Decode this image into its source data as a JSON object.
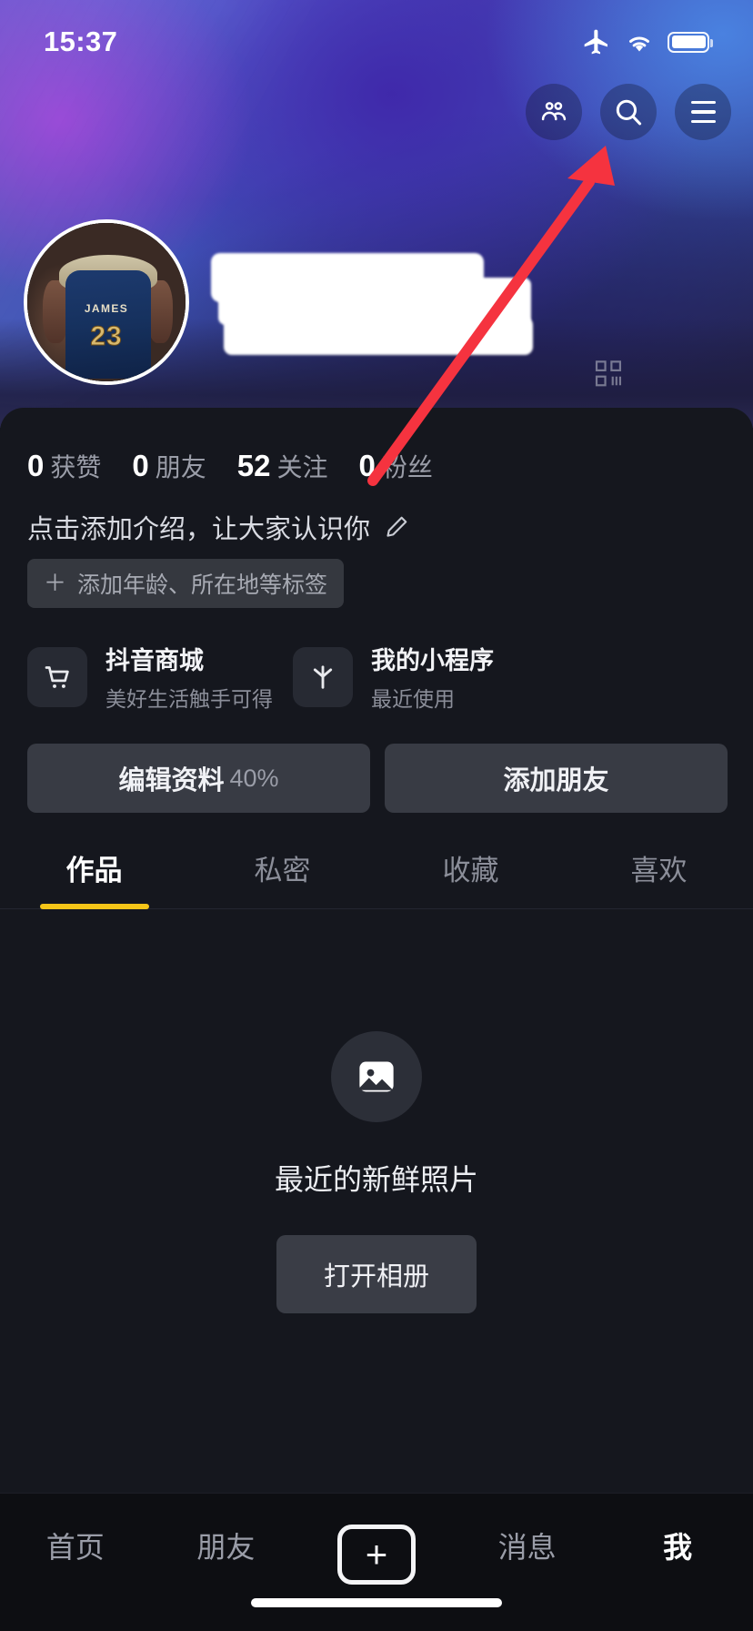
{
  "status_bar": {
    "time": "15:37",
    "icons": [
      "airplane-mode-icon",
      "wifi-icon",
      "battery-icon"
    ]
  },
  "header": {
    "actions": [
      {
        "name": "friends-icon",
        "label": ""
      },
      {
        "name": "search-icon",
        "label": ""
      },
      {
        "name": "menu-icon",
        "label": ""
      }
    ]
  },
  "profile": {
    "avatar_alt": "JAMES 23",
    "avatar_jersey_name": "JAMES",
    "avatar_jersey_number": "23",
    "username_redacted": true,
    "stats": [
      {
        "value": "0",
        "label": "获赞"
      },
      {
        "value": "0",
        "label": "朋友"
      },
      {
        "value": "52",
        "label": "关注"
      },
      {
        "value": "0",
        "label": "粉丝"
      }
    ],
    "bio_prompt": "点击添加介绍，让大家认识你",
    "tag_add": "添加年龄、所在地等标签",
    "tag_plus": "＋"
  },
  "entries": [
    {
      "icon": "cart-icon",
      "title": "抖音商城",
      "subtitle": "美好生活触手可得"
    },
    {
      "icon": "miniapp-icon",
      "title": "我的小程序",
      "subtitle": "最近使用"
    }
  ],
  "actions": {
    "edit_profile": "编辑资料",
    "edit_progress": "40%",
    "add_friend": "添加朋友"
  },
  "tabs": [
    {
      "label": "作品",
      "active": true
    },
    {
      "label": "私密",
      "active": false
    },
    {
      "label": "收藏",
      "active": false
    },
    {
      "label": "喜欢",
      "active": false
    }
  ],
  "empty_state": {
    "icon": "photo-icon",
    "title": "最近的新鲜照片",
    "button": "打开相册"
  },
  "bottom_nav": [
    {
      "label": "首页",
      "active": false
    },
    {
      "label": "朋友",
      "active": false
    },
    {
      "label": "",
      "active": false,
      "icon": "plus-icon"
    },
    {
      "label": "消息",
      "active": false
    },
    {
      "label": "我",
      "active": true
    }
  ],
  "annotation": {
    "type": "arrow",
    "color": "#f5333f",
    "points_to": "menu-icon"
  },
  "colors": {
    "accent_yellow": "#f5c518",
    "annotation_red": "#f5333f",
    "panel_bg": "#15171e",
    "tabbar_bg": "#0d0e12"
  }
}
